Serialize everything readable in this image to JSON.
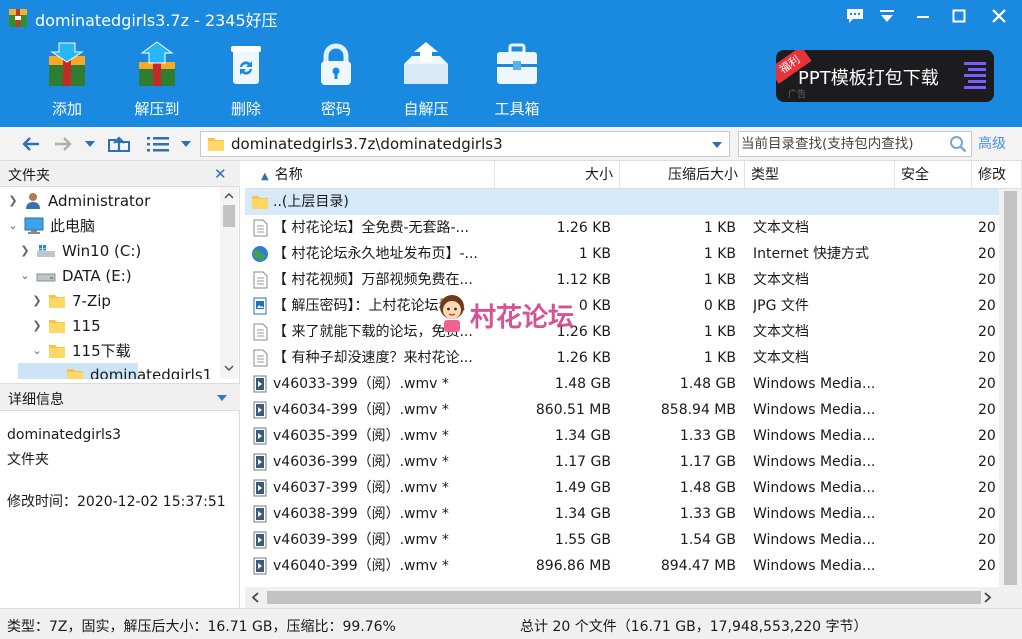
{
  "window": {
    "title": "dominatedgirls3.7z - 2345好压",
    "colors": {
      "titlebar": "#1a8ae0",
      "selection": "#d6e9f8",
      "accent": "#4a90d9"
    }
  },
  "toolbar": {
    "items": [
      {
        "label": "添加",
        "icon": "add-archive-icon"
      },
      {
        "label": "解压到",
        "icon": "extract-to-icon"
      },
      {
        "label": "删除",
        "icon": "trash-icon"
      },
      {
        "label": "密码",
        "icon": "lock-icon"
      },
      {
        "label": "自解压",
        "icon": "self-extract-icon"
      },
      {
        "label": "工具箱",
        "icon": "toolbox-icon"
      }
    ]
  },
  "ad": {
    "tag": "福利",
    "text": "PPT模板打包下载",
    "small": "广告"
  },
  "nav": {
    "path": "dominatedgirls3.7z\\dominatedgirls3",
    "search_placeholder": "当前目录查找(支持包内查找)",
    "advanced": "高级"
  },
  "folders": {
    "header": "文件夹",
    "tree": [
      {
        "label": "Administrator",
        "icon": "user-icon"
      },
      {
        "label": "此电脑",
        "icon": "computer-icon"
      },
      {
        "label": "Win10 (C:)",
        "icon": "windows-drive-icon"
      },
      {
        "label": "DATA (E:)",
        "icon": "drive-icon"
      },
      {
        "label": "7-Zip",
        "icon": "folder-icon"
      },
      {
        "label": "115",
        "icon": "folder-icon"
      },
      {
        "label": "115下载",
        "icon": "folder-icon"
      },
      {
        "label": "dominatedgirls1",
        "icon": "folder-icon"
      }
    ]
  },
  "details": {
    "header": "详细信息",
    "name": "dominatedgirls3",
    "kind": "文件夹",
    "modified": "修改时间：2020-12-02 15:37:51"
  },
  "columns": {
    "name": "名称",
    "size": "大小",
    "compressed": "压缩后大小",
    "type": "类型",
    "security": "安全",
    "modified": "修改"
  },
  "files": [
    {
      "name": "..(上层目录)",
      "size": "",
      "compressed": "",
      "type": "",
      "modified": "",
      "icon": "folder-icon"
    },
    {
      "name": "【 村花论坛】全免费-无套路-...",
      "size": "1.26 KB",
      "compressed": "1 KB",
      "type": "文本文档",
      "modified": "20",
      "icon": "text-file-icon"
    },
    {
      "name": "【 村花论坛永久地址发布页】-...",
      "size": "1 KB",
      "compressed": "1 KB",
      "type": "Internet 快捷方式",
      "modified": "20",
      "icon": "globe-icon"
    },
    {
      "name": "【 村花视频】万部视频免费在...",
      "size": "1.12 KB",
      "compressed": "1 KB",
      "type": "文本文档",
      "modified": "20",
      "icon": "text-file-icon"
    },
    {
      "name": "【 解压密码】：上村花论坛看...",
      "size": "0 KB",
      "compressed": "0 KB",
      "type": "JPG 文件",
      "modified": "20",
      "icon": "image-file-icon"
    },
    {
      "name": "【 来了就能下载的论坛，免费...",
      "size": "1.26 KB",
      "compressed": "1 KB",
      "type": "文本文档",
      "modified": "20",
      "icon": "text-file-icon"
    },
    {
      "name": "【 有种子却没速度？来村花论...",
      "size": "1.26 KB",
      "compressed": "1 KB",
      "type": "文本文档",
      "modified": "20",
      "icon": "text-file-icon"
    },
    {
      "name": "v46033-399（阅）.wmv *",
      "size": "1.48 GB",
      "compressed": "1.48 GB",
      "type": "Windows Media...",
      "modified": "20",
      "icon": "video-file-icon"
    },
    {
      "name": "v46034-399（阅）.wmv *",
      "size": "860.51 MB",
      "compressed": "858.94 MB",
      "type": "Windows Media...",
      "modified": "20",
      "icon": "video-file-icon"
    },
    {
      "name": "v46035-399（阅）.wmv *",
      "size": "1.34 GB",
      "compressed": "1.33 GB",
      "type": "Windows Media...",
      "modified": "20",
      "icon": "video-file-icon"
    },
    {
      "name": "v46036-399（阅）.wmv *",
      "size": "1.17 GB",
      "compressed": "1.17 GB",
      "type": "Windows Media...",
      "modified": "20",
      "icon": "video-file-icon"
    },
    {
      "name": "v46037-399（阅）.wmv *",
      "size": "1.49 GB",
      "compressed": "1.48 GB",
      "type": "Windows Media...",
      "modified": "20",
      "icon": "video-file-icon"
    },
    {
      "name": "v46038-399（阅）.wmv *",
      "size": "1.34 GB",
      "compressed": "1.33 GB",
      "type": "Windows Media...",
      "modified": "20",
      "icon": "video-file-icon"
    },
    {
      "name": "v46039-399（阅）.wmv *",
      "size": "1.55 GB",
      "compressed": "1.54 GB",
      "type": "Windows Media...",
      "modified": "20",
      "icon": "video-file-icon"
    },
    {
      "name": "v46040-399（阅）.wmv *",
      "size": "896.86 MB",
      "compressed": "894.47 MB",
      "type": "Windows Media...",
      "modified": "20",
      "icon": "video-file-icon"
    }
  ],
  "watermark": "村花论坛",
  "status": {
    "left": "类型：7Z，固实，解压后大小：16.71 GB，压缩比：99.76%",
    "right": "总计 20 个文件（16.71 GB，17,948,553,220 字节）"
  }
}
